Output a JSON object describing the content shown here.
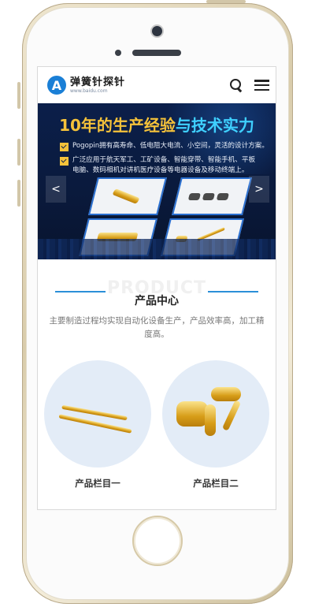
{
  "site": {
    "logo_letter": "A",
    "logo_name": "弹簧针探针",
    "logo_url": "www.baidu.com"
  },
  "header": {
    "icons": [
      "search-icon",
      "menu-icon"
    ]
  },
  "banner": {
    "title_part1": "10年的生产经验",
    "title_part2": "与技术实力",
    "bullet1": "Pogopin拥有高寿命、低电阻大电流、小空间，灵活的设计方案。",
    "bullet2_line1": "广泛应用于航天军工、工矿设备、智能穿带、智能手机、平板",
    "bullet2_line2": "电脑、数码相机对讲机医疗设备等电器设备及移动终端上。",
    "prev_label": "<",
    "next_label": ">"
  },
  "product_section": {
    "title_en": "PRODUCT",
    "title_cn": "产品中心",
    "description": "主要制造过程均实现自动化设备生产，产品效率高，加工精度高。",
    "items": [
      {
        "name": "产品栏目一"
      },
      {
        "name": "产品栏目二"
      }
    ]
  },
  "colors": {
    "accent": "#2b8fd8",
    "banner_bg": "#0b1f4a",
    "banner_yellow": "#f5c23a",
    "banner_cyan": "#3fd0ff"
  }
}
